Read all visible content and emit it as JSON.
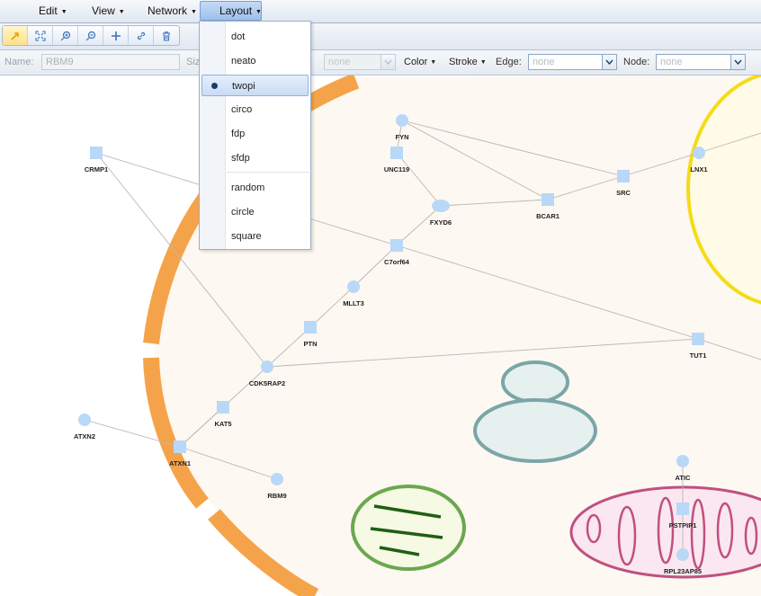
{
  "menubar": {
    "edit": "Edit",
    "view": "View",
    "network": "Network",
    "layout": "Layout"
  },
  "toolbar": {
    "buttons": [
      {
        "icon": "select-arrow-icon",
        "selected": true
      },
      {
        "icon": "fit-screen-icon",
        "selected": false
      },
      {
        "icon": "zoom-in-icon",
        "selected": false
      },
      {
        "icon": "zoom-out-icon",
        "selected": false
      },
      {
        "icon": "add-node-icon",
        "selected": false
      },
      {
        "icon": "add-edge-icon",
        "selected": false
      },
      {
        "icon": "delete-icon",
        "selected": false
      }
    ]
  },
  "props": {
    "name_label": "Name:",
    "name_placeholder": "RBM9",
    "size_label": "Siz",
    "shape_value": "none",
    "color_label": "Color",
    "stroke_label": "Stroke",
    "edge_label": "Edge:",
    "edge_value": "none",
    "node_label": "Node:",
    "node_value": "none"
  },
  "layout_menu": {
    "items": [
      {
        "label": "dot",
        "selected": false
      },
      {
        "label": "neato",
        "selected": false
      },
      {
        "label": "twopi",
        "selected": true
      },
      {
        "label": "circo",
        "selected": false
      },
      {
        "label": "fdp",
        "selected": false
      },
      {
        "label": "sfdp",
        "selected": false
      },
      {
        "label": "random",
        "selected": false
      },
      {
        "label": "circle",
        "selected": false
      },
      {
        "label": "square",
        "selected": false
      }
    ]
  },
  "colors": {
    "node_fill": "#b9d8f7",
    "edge": "#b8b8b8",
    "membrane": "#f5a34a",
    "cytoplasm": "#fdf8f1",
    "nucleus_stroke": "#f4dc17",
    "nucleus_fill": "#fffbe6",
    "golgi": "#7aa6a6",
    "chloroplast": "#6aa84f",
    "mitochondrion": "#c0507f",
    "menu_highlight": "#c9dcf5"
  },
  "network": {
    "nodes": [
      {
        "id": "CRMP1",
        "shape": "square"
      },
      {
        "id": "FYN",
        "shape": "circle"
      },
      {
        "id": "UNC119",
        "shape": "square"
      },
      {
        "id": "FXYD6",
        "shape": "ellipse"
      },
      {
        "id": "BCAR1",
        "shape": "square"
      },
      {
        "id": "SRC",
        "shape": "square"
      },
      {
        "id": "LNX1",
        "shape": "circle"
      },
      {
        "id": "C7orf64",
        "shape": "square"
      },
      {
        "id": "MLLT3",
        "shape": "circle"
      },
      {
        "id": "PTN",
        "shape": "square"
      },
      {
        "id": "CDK5RAP2",
        "shape": "circle"
      },
      {
        "id": "TUT1",
        "shape": "square"
      },
      {
        "id": "KAT5",
        "shape": "square"
      },
      {
        "id": "ATXN2",
        "shape": "circle"
      },
      {
        "id": "ATXN1",
        "shape": "square"
      },
      {
        "id": "RBM9",
        "shape": "circle"
      },
      {
        "id": "ATIC",
        "shape": "circle"
      },
      {
        "id": "PSTPIP1",
        "shape": "square"
      },
      {
        "id": "RPL23AP85",
        "shape": "circle"
      }
    ],
    "edges": [
      [
        "CRMP1",
        "CDK5RAP2"
      ],
      [
        "CRMP1",
        "C7orf64"
      ],
      [
        "FYN",
        "UNC119"
      ],
      [
        "FYN",
        "BCAR1"
      ],
      [
        "FYN",
        "SRC"
      ],
      [
        "UNC119",
        "FXYD6"
      ],
      [
        "FXYD6",
        "BCAR1"
      ],
      [
        "FXYD6",
        "C7orf64"
      ],
      [
        "BCAR1",
        "SRC"
      ],
      [
        "SRC",
        "LNX1"
      ],
      [
        "C7orf64",
        "TUT1"
      ],
      [
        "C7orf64",
        "MLLT3"
      ],
      [
        "MLLT3",
        "PTN"
      ],
      [
        "PTN",
        "CDK5RAP2"
      ],
      [
        "CDK5RAP2",
        "TUT1"
      ],
      [
        "CDK5RAP2",
        "ATXN1"
      ],
      [
        "KAT5",
        "ATXN1"
      ],
      [
        "ATXN2",
        "ATXN1"
      ],
      [
        "ATXN1",
        "RBM9"
      ],
      [
        "ATIC",
        "PSTPIP1"
      ],
      [
        "PSTPIP1",
        "RPL23AP85"
      ]
    ]
  }
}
